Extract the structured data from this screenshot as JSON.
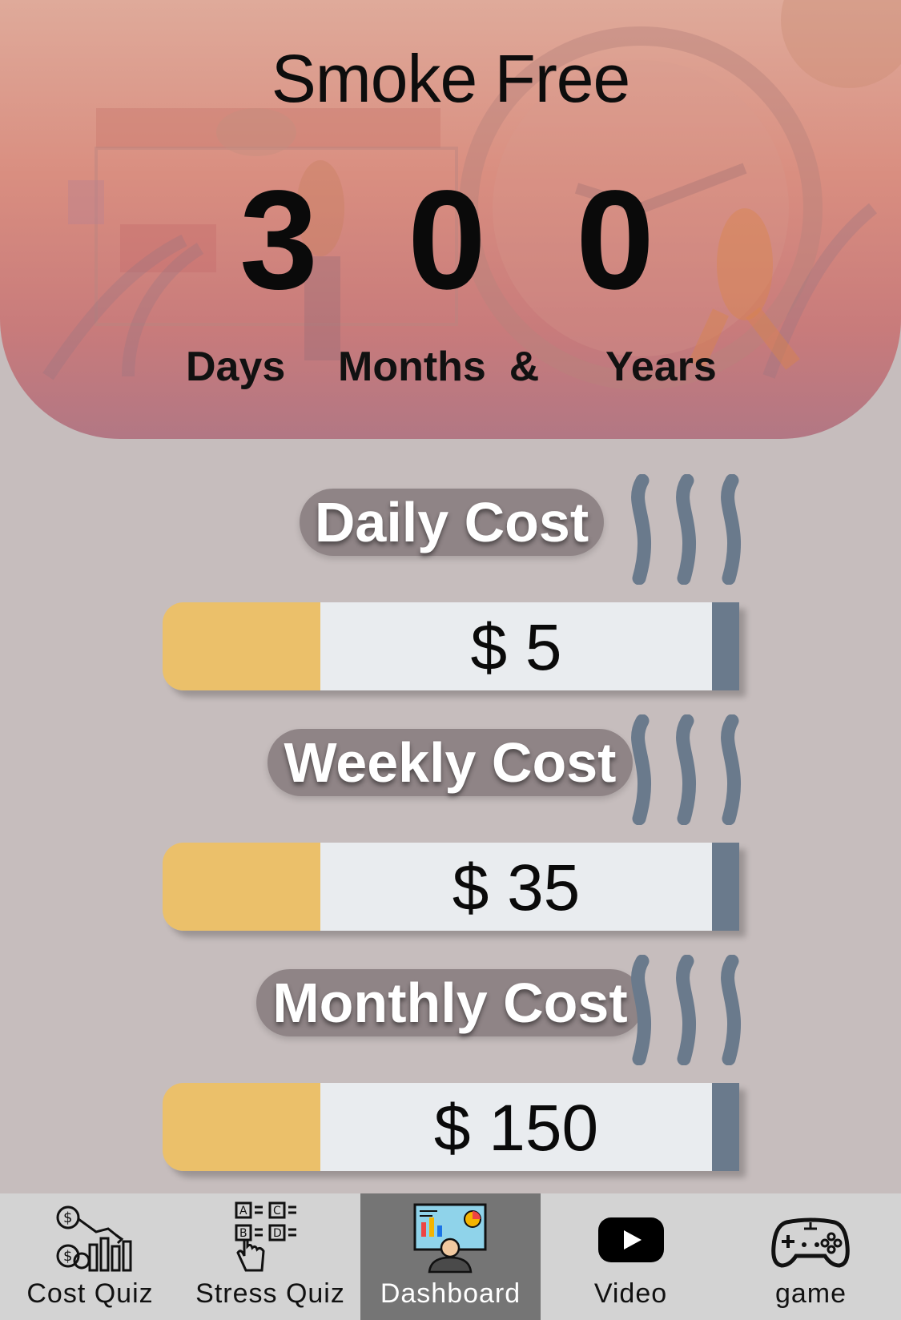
{
  "header": {
    "title": "Smoke Free",
    "counters": [
      {
        "value": "3",
        "unit": "Days"
      },
      {
        "value": "0",
        "unit": "Months  &"
      },
      {
        "value": "0",
        "unit": "Years"
      }
    ]
  },
  "costs": [
    {
      "label": "Daily Cost",
      "amount": "$ 5"
    },
    {
      "label": "Weekly Cost",
      "amount": "$ 35"
    },
    {
      "label": "Monthly Cost",
      "amount": "$ 150"
    }
  ],
  "tabs": [
    {
      "label": "Cost Quiz",
      "icon": "money-chart-icon",
      "active": false
    },
    {
      "label": "Stress Quiz",
      "icon": "quiz-options-icon",
      "active": false
    },
    {
      "label": "Dashboard",
      "icon": "dashboard-presenter-icon",
      "active": true
    },
    {
      "label": "Video",
      "icon": "youtube-play-icon",
      "active": false
    },
    {
      "label": "game",
      "icon": "gamepad-icon",
      "active": false
    }
  ],
  "colors": {
    "background": "#c6bdbd",
    "filter": "#ebc06a",
    "paper": "#e9ecef",
    "ash": "#6a7a8c",
    "smoke": "#6a7a8c",
    "active_tab": "#757575",
    "tabbar": "#d3d3d3"
  }
}
